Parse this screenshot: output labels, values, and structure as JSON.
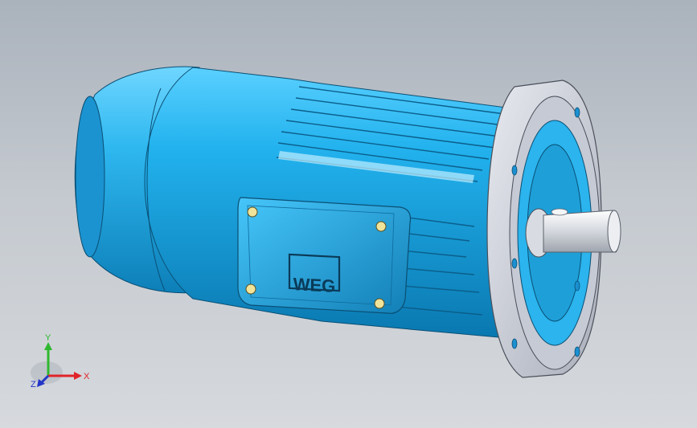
{
  "view": {
    "background_top": "#aab2bc",
    "background_bottom": "#d6d9dd"
  },
  "model": {
    "body_color": "#2bb4ee",
    "flange_color": "#c9cdd6",
    "shaft_color": "#e6e8ec",
    "logo_text": "WEG"
  },
  "triad": {
    "x_label": "X",
    "y_label": "Y",
    "z_label": "Z",
    "x_color": "#e0242a",
    "y_color": "#2fb82f",
    "z_color": "#2336c8"
  }
}
